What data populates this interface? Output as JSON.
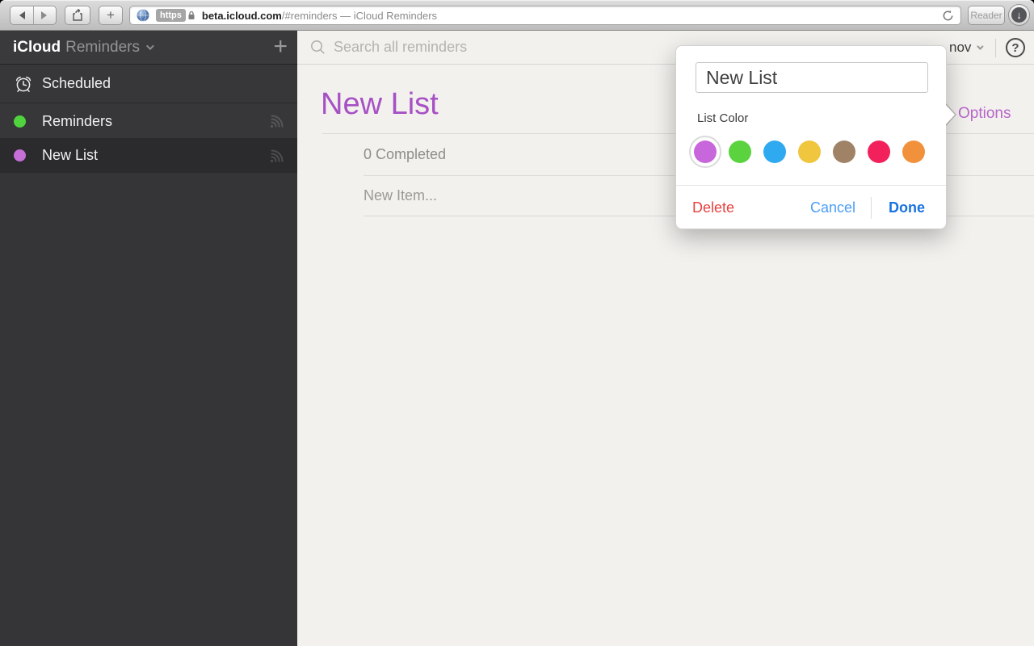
{
  "browser": {
    "https_label": "https",
    "url_domain": "beta.icloud.com",
    "url_rest": "/#reminders — iCloud Reminders",
    "reader_label": "Reader"
  },
  "sidebar": {
    "app_bold": "iCloud",
    "app_name": "Reminders",
    "items": [
      {
        "label": "Scheduled",
        "icon": "alarm-clock"
      },
      {
        "label": "Reminders",
        "color": "#50d43e",
        "shared": true
      },
      {
        "label": "New List",
        "color": "#c66fd8",
        "shared": true,
        "selected": true
      }
    ]
  },
  "header": {
    "search_placeholder": "Search all reminders",
    "account_name": "nov",
    "help_label": "?"
  },
  "main": {
    "title": "New List",
    "completed_label": "0 Completed",
    "new_item_placeholder": "New Item...",
    "options_label": "Options"
  },
  "popover": {
    "name_value": "New List",
    "list_color_label": "List Color",
    "colors": [
      "#c866dc",
      "#5ad33e",
      "#2fa9f0",
      "#efc63e",
      "#a08367",
      "#f2215c",
      "#f2913b"
    ],
    "selected_color_index": 0,
    "delete_label": "Delete",
    "cancel_label": "Cancel",
    "done_label": "Done"
  }
}
